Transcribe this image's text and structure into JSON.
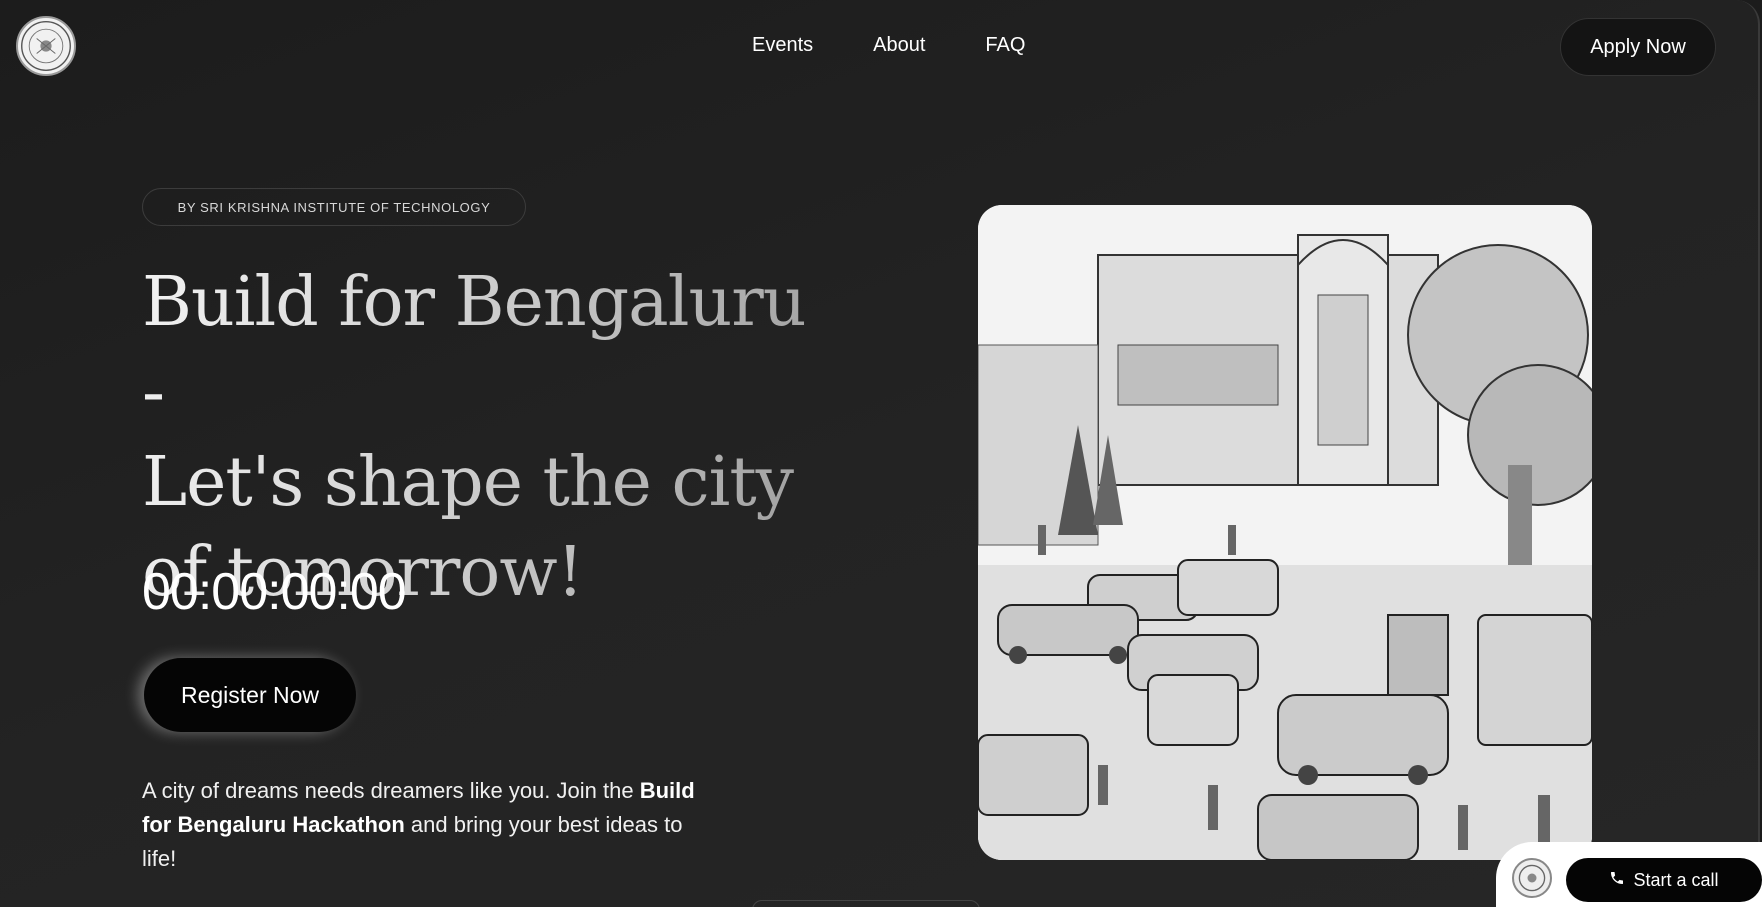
{
  "header": {
    "logo_icon": "institute-seal-logo",
    "nav": [
      {
        "label": "Events"
      },
      {
        "label": "About"
      },
      {
        "label": "FAQ"
      }
    ],
    "apply_label": "Apply Now"
  },
  "hero": {
    "tagline": "BY SRI KRISHNA INSTITUTE OF TECHNOLOGY",
    "title_line1": "Build for Bengaluru -",
    "title_line2": "Let's shape the city",
    "title_line3": "of tomorrow!",
    "countdown": "00:00:00:00",
    "register_label": "Register Now",
    "description_part1": "A city of dreams needs dreamers like you. Join the ",
    "description_bold": "Build for Bengaluru Hackathon",
    "description_part2": " and bring your best ideas to life!",
    "image_icon": "bengaluru-street-sketch-illustration"
  },
  "call_widget": {
    "avatar_icon": "institute-seal-avatar",
    "phone_icon": "phone-icon",
    "call_label": "Start a call"
  },
  "colors": {
    "background": "#1e1e1e",
    "text": "#ffffff",
    "button_dark": "#050505"
  }
}
